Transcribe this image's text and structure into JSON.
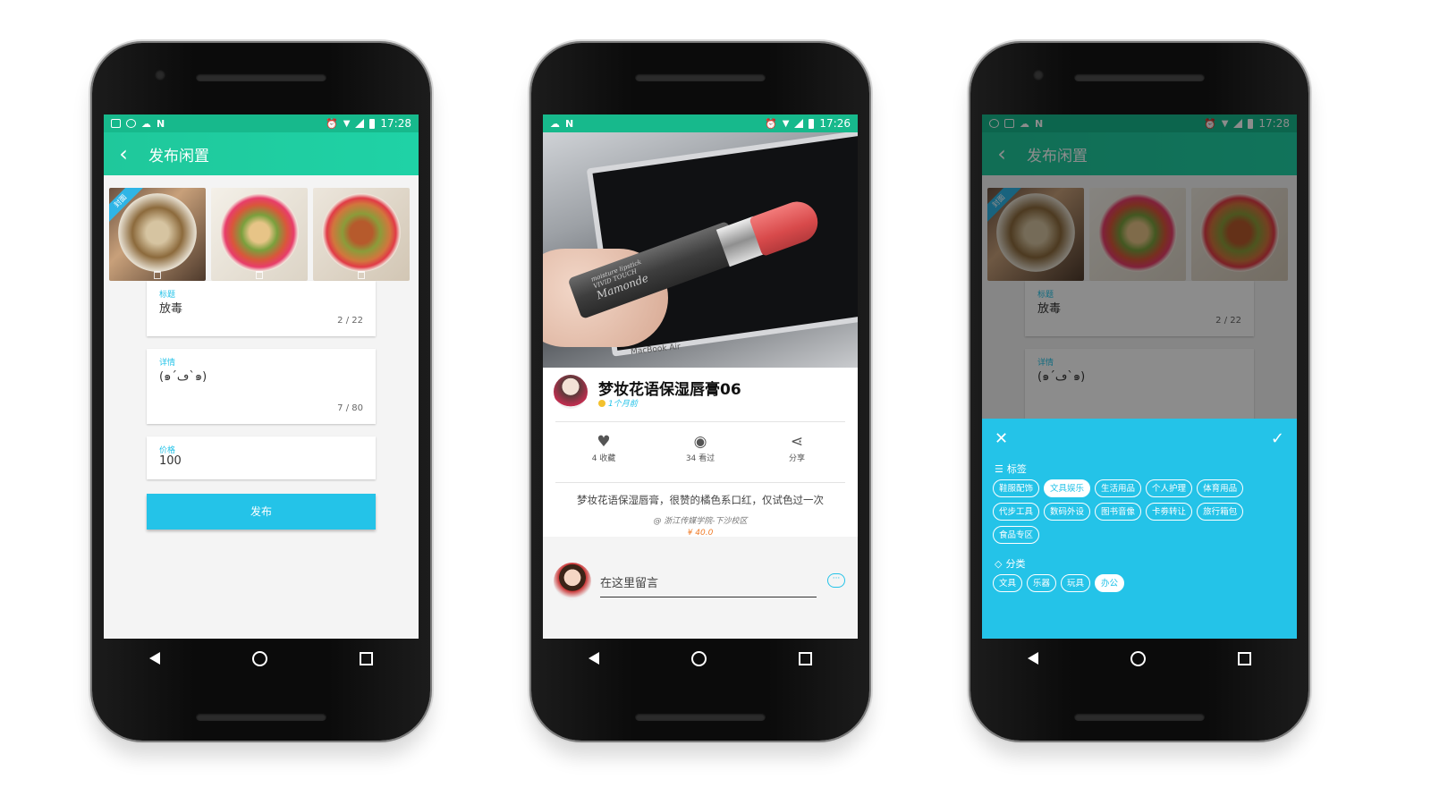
{
  "colors": {
    "primary": "#1fc89b",
    "accent": "#24c3e8",
    "price": "#f07b27"
  },
  "phone1": {
    "status": {
      "time": "17:28",
      "left_icons": [
        "image-icon",
        "pi-icon",
        "cloud-icon",
        "n-icon"
      ],
      "right_icons": [
        "alarm-icon",
        "wifi-icon",
        "signal-icon",
        "battery-icon"
      ]
    },
    "toolbar": {
      "title": "发布闲置",
      "back_icon": "back-arrow-icon"
    },
    "photos": [
      {
        "badge": "封面",
        "trash_icon": "trash-icon"
      },
      {
        "badge": "",
        "trash_icon": "trash-icon"
      },
      {
        "badge": "",
        "trash_icon": "trash-icon"
      }
    ],
    "form": {
      "title_label": "标题",
      "title_value": "放毒",
      "title_count": "2 / 22",
      "detail_label": "详情",
      "detail_value": "(๑´ڡ`๑)",
      "detail_count": "7 / 80",
      "price_label": "价格",
      "price_value": "100",
      "submit_label": "发布"
    }
  },
  "phone2": {
    "status": {
      "time": "17:26",
      "left_icons": [
        "cloud-icon",
        "n-icon"
      ],
      "right_icons": [
        "alarm-icon",
        "wifi-icon",
        "signal-icon",
        "battery-icon"
      ]
    },
    "product": {
      "title": "梦妆花语保湿唇膏06",
      "time": "1个月前",
      "image_text": {
        "brand": "Mamonde",
        "line": "VIVID TOUCH",
        "sub": "moisture lipstick",
        "laptop": "MacBook Air"
      },
      "actions": [
        {
          "icon": "heart-icon",
          "label": "4 收藏"
        },
        {
          "icon": "eye-icon",
          "label": "34 看过"
        },
        {
          "icon": "share-icon",
          "label": "分享"
        }
      ],
      "description": "梦妆花语保湿唇膏，很赞的橘色系口红，仅试色过一次",
      "location": "@ 浙江传媒学院-下沙校区",
      "price": "¥ 40.0"
    },
    "comment": {
      "placeholder": "在这里留言",
      "send_icon": "chat-bubble-icon"
    }
  },
  "phone3": {
    "status": {
      "time": "17:28",
      "left_icons": [
        "pi-icon",
        "image-icon",
        "cloud-icon",
        "n-icon"
      ],
      "right_icons": [
        "alarm-icon",
        "wifi-icon",
        "signal-icon",
        "battery-icon"
      ]
    },
    "toolbar": {
      "title": "发布闲置"
    },
    "form": {
      "title_label": "标题",
      "title_value": "放毒",
      "title_count": "2 / 22",
      "detail_label": "详情",
      "detail_value": "(๑´ڡ`๑)"
    },
    "sheet": {
      "close_icon": "close-icon",
      "confirm_icon": "check-icon",
      "tags_title": "标签",
      "tags": [
        {
          "label": "鞋服配饰",
          "selected": false
        },
        {
          "label": "文具娱乐",
          "selected": true
        },
        {
          "label": "生活用品",
          "selected": false
        },
        {
          "label": "个人护理",
          "selected": false
        },
        {
          "label": "体育用品",
          "selected": false
        },
        {
          "label": "代步工具",
          "selected": false
        },
        {
          "label": "数码外设",
          "selected": false
        },
        {
          "label": "图书音像",
          "selected": false
        },
        {
          "label": "卡劵转让",
          "selected": false
        },
        {
          "label": "旅行箱包",
          "selected": false
        },
        {
          "label": "食品专区",
          "selected": false
        }
      ],
      "category_title": "分类",
      "categories": [
        {
          "label": "文具",
          "selected": false
        },
        {
          "label": "乐器",
          "selected": false
        },
        {
          "label": "玩具",
          "selected": false
        },
        {
          "label": "办公",
          "selected": true
        }
      ]
    }
  }
}
